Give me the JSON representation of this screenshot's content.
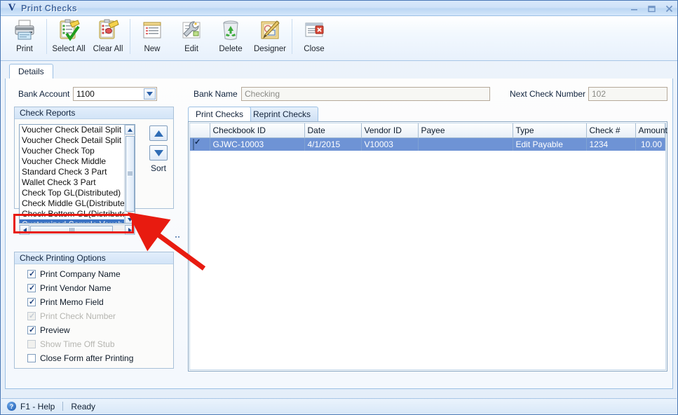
{
  "window": {
    "title": "Print Checks",
    "logo_glyph": "V",
    "controls": [
      {
        "name": "minimize",
        "glyph": "–"
      },
      {
        "name": "maximize",
        "glyph": "☐"
      },
      {
        "name": "close",
        "glyph": "✕"
      }
    ]
  },
  "toolbar": {
    "buttons": [
      {
        "label": "Print",
        "icon": "printer-icon"
      },
      {
        "label": "Select All",
        "icon": "clipboard-check-icon"
      },
      {
        "label": "Clear All",
        "icon": "clipboard-eraser-icon"
      },
      {
        "label": "New",
        "icon": "new-document-icon"
      },
      {
        "label": "Edit",
        "icon": "wrench-icon"
      },
      {
        "label": "Delete",
        "icon": "recycle-bin-icon"
      },
      {
        "label": "Designer",
        "icon": "designer-pencil-icon"
      },
      {
        "label": "Close",
        "icon": "close-window-icon"
      }
    ]
  },
  "tabs": {
    "details": "Details"
  },
  "form": {
    "bank_account_label": "Bank Account",
    "bank_account_value": "1100",
    "bank_name_label": "Bank Name",
    "bank_name_value": "Checking",
    "next_check_label": "Next Check Number",
    "next_check_value": "102"
  },
  "check_reports": {
    "header": "Check Reports",
    "items": [
      {
        "label": "Voucher Check Detail Split Middle",
        "selected": false
      },
      {
        "label": "Voucher Check Detail Split Bottom",
        "selected": false
      },
      {
        "label": "Voucher Check Top",
        "selected": false
      },
      {
        "label": "Voucher Check Middle",
        "selected": false
      },
      {
        "label": "Standard Check 3 Part",
        "selected": false
      },
      {
        "label": "Wallet Check 3 Part",
        "selected": false
      },
      {
        "label": "Check Top GL(Distributed)",
        "selected": false
      },
      {
        "label": "Check Middle GL(Distributed)",
        "selected": false
      },
      {
        "label": "Check Bottom GL(Distributed)",
        "selected": false
      },
      {
        "label": "Customized Sample Voucher Detail",
        "selected": true
      }
    ],
    "sort_label": "Sort"
  },
  "printing_options": {
    "header": "Check Printing Options",
    "items": [
      {
        "label": "Print Company Name",
        "checked": true,
        "disabled": false
      },
      {
        "label": "Print Vendor Name",
        "checked": true,
        "disabled": false
      },
      {
        "label": "Print Memo Field",
        "checked": true,
        "disabled": false
      },
      {
        "label": "Print Check Number",
        "checked": true,
        "disabled": true
      },
      {
        "label": "Preview",
        "checked": true,
        "disabled": false
      },
      {
        "label": "Show Time Off Stub",
        "checked": false,
        "disabled": true
      },
      {
        "label": "Close Form after Printing",
        "checked": false,
        "disabled": false
      }
    ]
  },
  "check_tabs": [
    {
      "label": "Print Checks",
      "active": true
    },
    {
      "label": "Reprint Checks",
      "active": false
    }
  ],
  "grid": {
    "columns": [
      "",
      "Checkbook ID",
      "Date",
      "Vendor ID",
      "Payee",
      "Type",
      "Check #",
      "Amount"
    ],
    "rows": [
      {
        "checked": true,
        "checkbook_id": "GJWC-10003",
        "date": "4/1/2015",
        "vendor_id": "V10003",
        "payee": "",
        "type": "Edit Payable",
        "check_number": "1234",
        "amount": "10.00",
        "selected": true
      }
    ]
  },
  "statusbar": {
    "help_glyph": "?",
    "help_text": "F1 - Help",
    "state_text": "Ready"
  },
  "annotation": {
    "highlight_color": "#e81b10"
  }
}
